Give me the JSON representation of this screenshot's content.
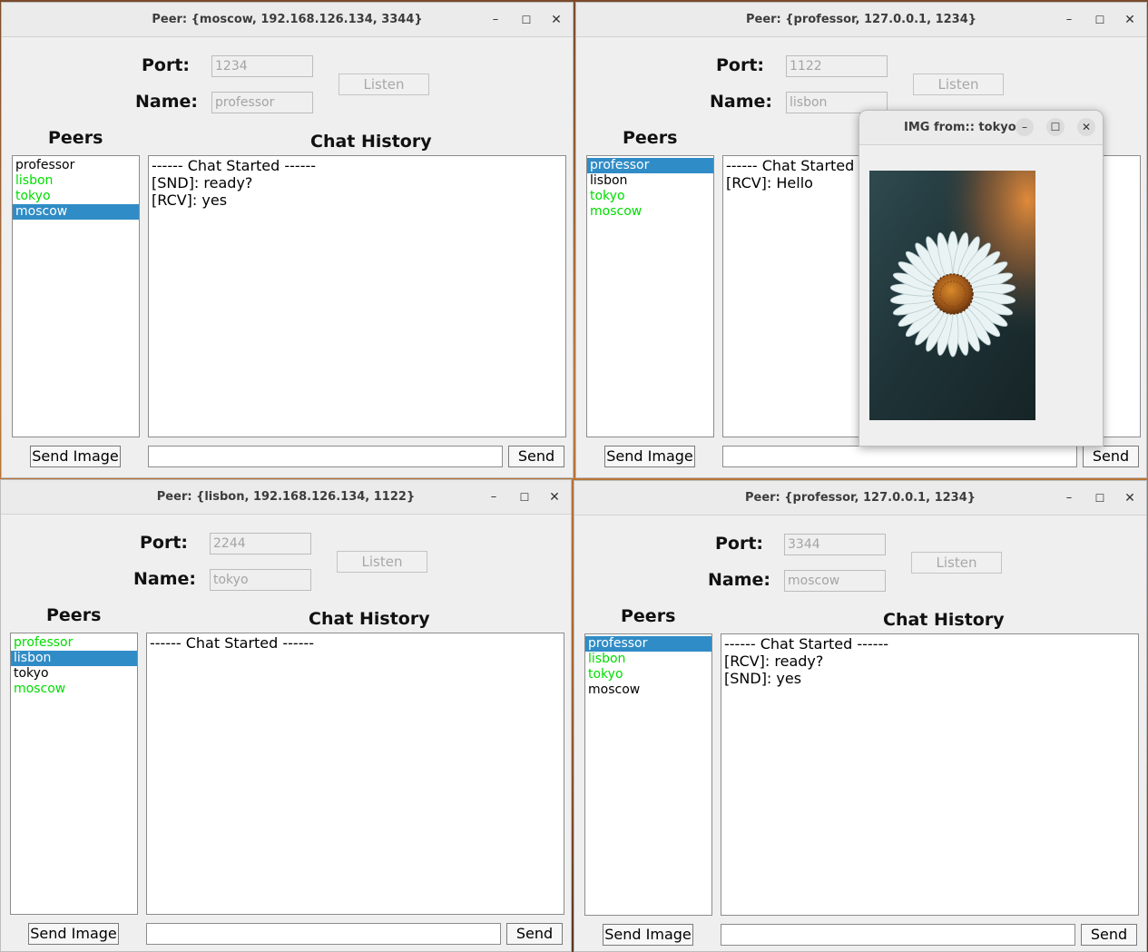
{
  "labels": {
    "port": "Port:",
    "name": "Name:",
    "listen": "Listen",
    "peers": "Peers",
    "chat_history": "Chat History",
    "send_image": "Send Image",
    "send": "Send"
  },
  "windows": [
    {
      "title": "Peer: {moscow, 192.168.126.134, 3344}",
      "port": "1234",
      "name": "professor",
      "show_chat_heading": true,
      "peers": [
        {
          "name": "professor",
          "online": false,
          "selected": false
        },
        {
          "name": "lisbon",
          "online": true,
          "selected": false
        },
        {
          "name": "tokyo",
          "online": true,
          "selected": false
        },
        {
          "name": "moscow",
          "online": false,
          "selected": true
        }
      ],
      "chat": [
        "------ Chat Started ------",
        "[SND]: ready?",
        "[RCV]: yes"
      ]
    },
    {
      "title": "Peer: {professor, 127.0.0.1, 1234}",
      "port": "1122",
      "name": "lisbon",
      "show_chat_heading": false,
      "peers": [
        {
          "name": "professor",
          "online": false,
          "selected": true
        },
        {
          "name": "lisbon",
          "online": false,
          "selected": false
        },
        {
          "name": "tokyo",
          "online": true,
          "selected": false
        },
        {
          "name": "moscow",
          "online": true,
          "selected": false
        }
      ],
      "chat": [
        "------ Chat Started -",
        "[RCV]: Hello"
      ]
    },
    {
      "title": "Peer: {lisbon, 192.168.126.134, 1122}",
      "port": "2244",
      "name": "tokyo",
      "show_chat_heading": true,
      "peers": [
        {
          "name": "professor",
          "online": true,
          "selected": false
        },
        {
          "name": "lisbon",
          "online": false,
          "selected": true
        },
        {
          "name": "tokyo",
          "online": false,
          "selected": false
        },
        {
          "name": "moscow",
          "online": true,
          "selected": false
        }
      ],
      "chat": [
        "------ Chat Started ------"
      ]
    },
    {
      "title": "Peer: {professor, 127.0.0.1, 1234}",
      "port": "3344",
      "name": "moscow",
      "show_chat_heading": true,
      "peers": [
        {
          "name": "professor",
          "online": true,
          "selected": true
        },
        {
          "name": "lisbon",
          "online": true,
          "selected": false
        },
        {
          "name": "tokyo",
          "online": true,
          "selected": false
        },
        {
          "name": "moscow",
          "online": false,
          "selected": false
        }
      ],
      "chat": [
        "------ Chat Started ------",
        "[RCV]: ready?",
        "[SND]: yes"
      ]
    }
  ],
  "image_popup": {
    "title": "IMG from:: tokyo",
    "image_subject": "daisy-flower-image"
  },
  "colors": {
    "online_peer": "#00dd00",
    "selection": "#308cc6",
    "window_bg": "#efefef"
  },
  "icons": {
    "minimize": "–",
    "maximize": "☐",
    "close": "✕"
  }
}
